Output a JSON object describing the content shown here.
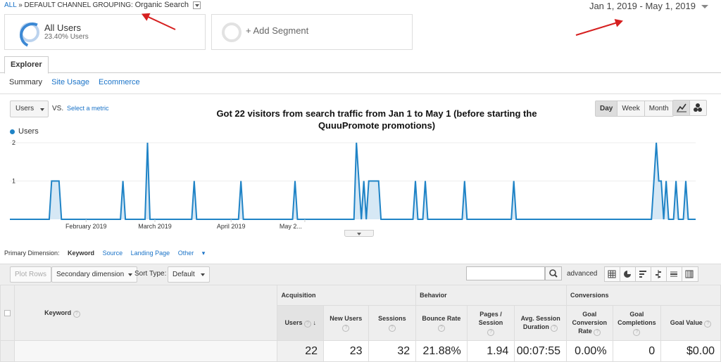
{
  "breadcrumb": {
    "all": "ALL",
    "sep": "»",
    "dimension": "DEFAULT CHANNEL GROUPING:",
    "value": "Organic Search"
  },
  "date_range": "Jan 1, 2019 - May 1, 2019",
  "segments": [
    {
      "title": "All Users",
      "subtitle": "23.40% Users"
    },
    {
      "title": "+ Add Segment"
    }
  ],
  "tabs": {
    "explorer": "Explorer"
  },
  "subtabs": [
    "Summary",
    "Site Usage",
    "Ecommerce"
  ],
  "chart_controls": {
    "metric": "Users",
    "vs": "VS.",
    "select_metric": "Select a metric",
    "granularity": [
      "Day",
      "Week",
      "Month"
    ],
    "active_granularity": "Day"
  },
  "annotation": "Got 22 visitors from search traffic from Jan 1 to May 1 (before starting the QuuuPromote promotions)",
  "chart_data": {
    "type": "area",
    "title": "",
    "xlabel": "",
    "ylabel": "",
    "series": [
      {
        "name": "Users",
        "color": "#1f83c6",
        "fill": "#d6e8f5",
        "values": [
          0,
          0,
          0,
          0,
          0,
          0,
          0,
          0,
          0,
          0,
          0,
          0,
          0,
          0,
          0,
          0,
          0,
          1,
          1,
          1,
          1,
          0,
          0,
          0,
          0,
          0,
          0,
          0,
          0,
          0,
          0,
          0,
          0,
          0,
          0,
          0,
          0,
          0,
          0,
          0,
          0,
          0,
          0,
          0,
          0,
          0,
          1,
          0,
          0,
          0,
          0,
          0,
          0,
          0,
          0,
          0,
          2,
          0,
          0,
          0,
          0,
          0,
          0,
          0,
          0,
          0,
          0,
          0,
          0,
          0,
          0,
          0,
          0,
          0,
          0,
          1,
          0,
          0,
          0,
          0,
          0,
          0,
          0,
          0,
          0,
          0,
          0,
          0,
          0,
          0,
          0,
          0,
          0,
          0,
          1,
          0,
          0,
          0,
          0,
          0,
          0,
          0,
          0,
          0,
          0,
          0,
          0,
          0,
          0,
          0,
          0,
          0,
          0,
          0,
          0,
          0,
          1,
          0,
          0,
          0,
          0,
          0,
          0,
          0,
          0,
          0,
          0,
          0,
          0,
          0,
          0,
          0,
          0,
          0,
          0,
          0,
          0,
          0,
          0,
          0,
          0,
          2,
          1,
          0,
          1,
          0,
          1,
          1,
          1,
          1,
          1,
          0,
          0,
          0,
          0,
          0,
          0,
          0,
          0,
          0,
          0,
          0,
          0,
          0,
          0,
          1,
          0,
          0,
          0,
          1,
          0,
          0,
          0,
          0,
          0,
          0,
          0,
          0,
          0,
          0,
          0,
          0,
          0,
          0,
          0,
          1,
          0,
          0,
          0,
          0,
          0,
          0,
          0,
          0,
          0,
          0,
          0,
          0,
          0,
          0,
          0,
          0,
          0,
          0,
          0,
          1,
          0,
          0,
          0,
          0,
          0,
          0,
          0,
          0,
          0,
          0,
          0,
          0,
          0,
          0,
          0,
          0,
          0,
          0,
          0,
          0,
          0,
          0,
          0,
          0,
          0,
          0,
          0,
          0,
          0,
          0,
          0,
          0,
          0,
          0,
          0,
          0,
          0,
          0,
          0,
          0,
          0,
          0,
          0,
          0,
          0,
          0,
          0,
          0,
          0,
          0,
          0,
          0,
          0,
          0,
          0,
          0,
          1,
          2,
          1,
          1,
          0,
          1,
          0,
          0,
          0,
          1,
          0,
          0,
          0,
          1,
          0,
          0,
          0,
          0
        ]
      }
    ],
    "ylim": [
      0,
      2
    ],
    "yticks": [
      "1",
      "2"
    ],
    "xticks": [
      "February 2019",
      "March 2019",
      "April 2019",
      "May 2..."
    ],
    "legend": "top-left",
    "grid": true
  },
  "primary_dimension": {
    "label": "Primary Dimension:",
    "options": [
      "Keyword",
      "Source",
      "Landing Page",
      "Other"
    ],
    "active": "Keyword"
  },
  "toolbar": {
    "plot_rows": "Plot Rows",
    "secondary_dimension": "Secondary dimension",
    "sort_type_label": "Sort Type:",
    "sort_type_value": "Default",
    "advanced": "advanced"
  },
  "table": {
    "first_col": "Keyword",
    "groups": [
      "Acquisition",
      "Behavior",
      "Conversions"
    ],
    "columns": [
      "Users",
      "New Users",
      "Sessions",
      "Bounce Rate",
      "Pages / Session",
      "Avg. Session Duration",
      "Goal Conversion Rate",
      "Goal Completions",
      "Goal Value"
    ],
    "values": [
      "22",
      "23",
      "32",
      "21.88%",
      "1.94",
      "00:07:55",
      "0.00%",
      "0",
      "$0.00"
    ]
  }
}
